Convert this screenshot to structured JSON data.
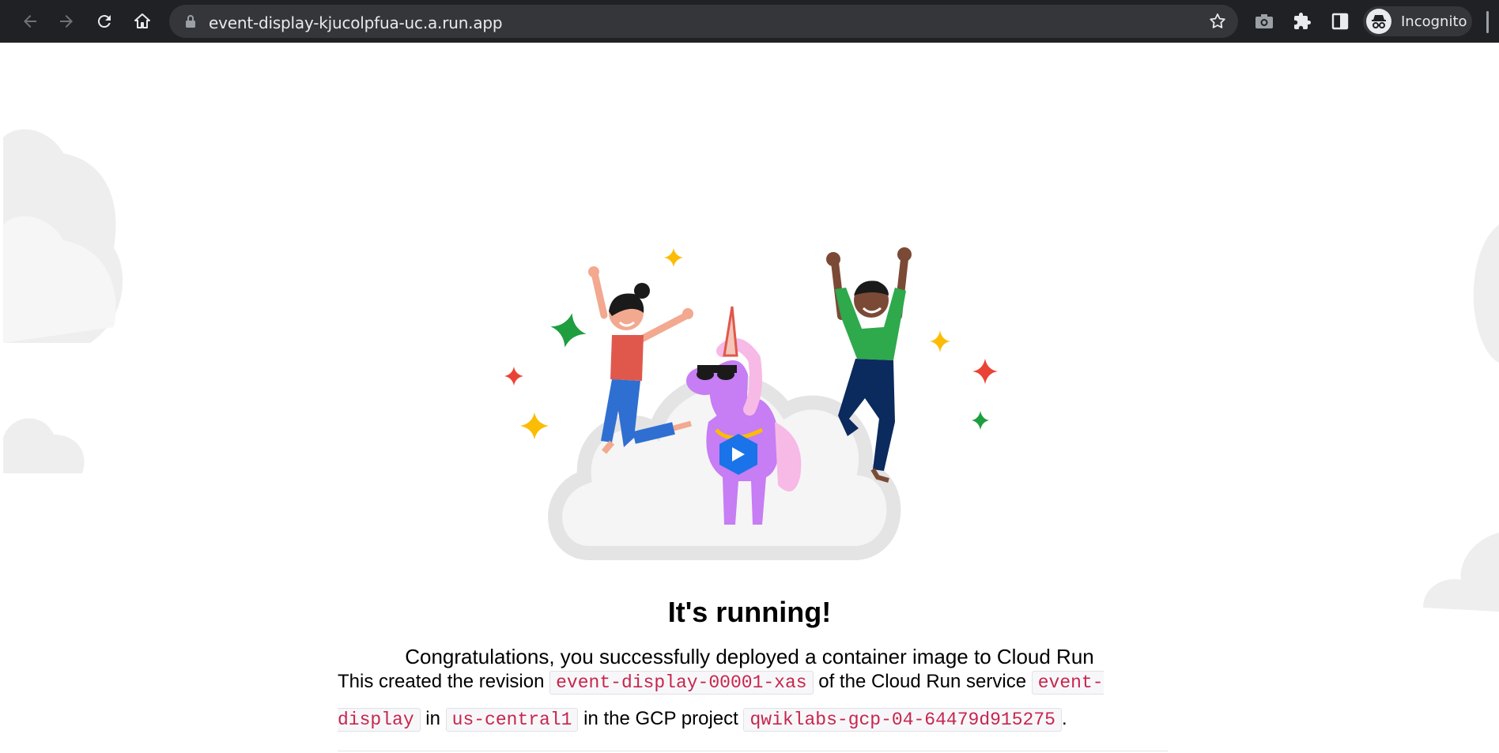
{
  "browser": {
    "url": "event-display-kjucolpfua-uc.a.run.app",
    "profile_label": "Incognito",
    "nav_icons": [
      "back-icon",
      "forward-icon",
      "reload-icon",
      "home-icon"
    ],
    "toolbar_icons": [
      "camera-icon",
      "extensions-icon",
      "side-panel-icon"
    ]
  },
  "main": {
    "title": "It's running!",
    "subtitle": "Congratulations, you successfully deployed a container image to Cloud Run",
    "paragraph": {
      "t1": "This created the revision ",
      "revision": "event-display-00001-xas",
      "t2": " of the Cloud Run service ",
      "service": "event-display",
      "t3": " in ",
      "region": "us-central1",
      "t4": " in the GCP project ",
      "project": "qwiklabs-gcp-04-64479d915275",
      "t5": "."
    }
  },
  "colors": {
    "chrome_bg": "#202124",
    "omnibox_bg": "#35363a",
    "code_text": "#c7254e",
    "sparkle_green": "#1e9e3f",
    "sparkle_yellow": "#fbbc04",
    "sparkle_red": "#ea4335",
    "unicorn": "#c77df3"
  }
}
